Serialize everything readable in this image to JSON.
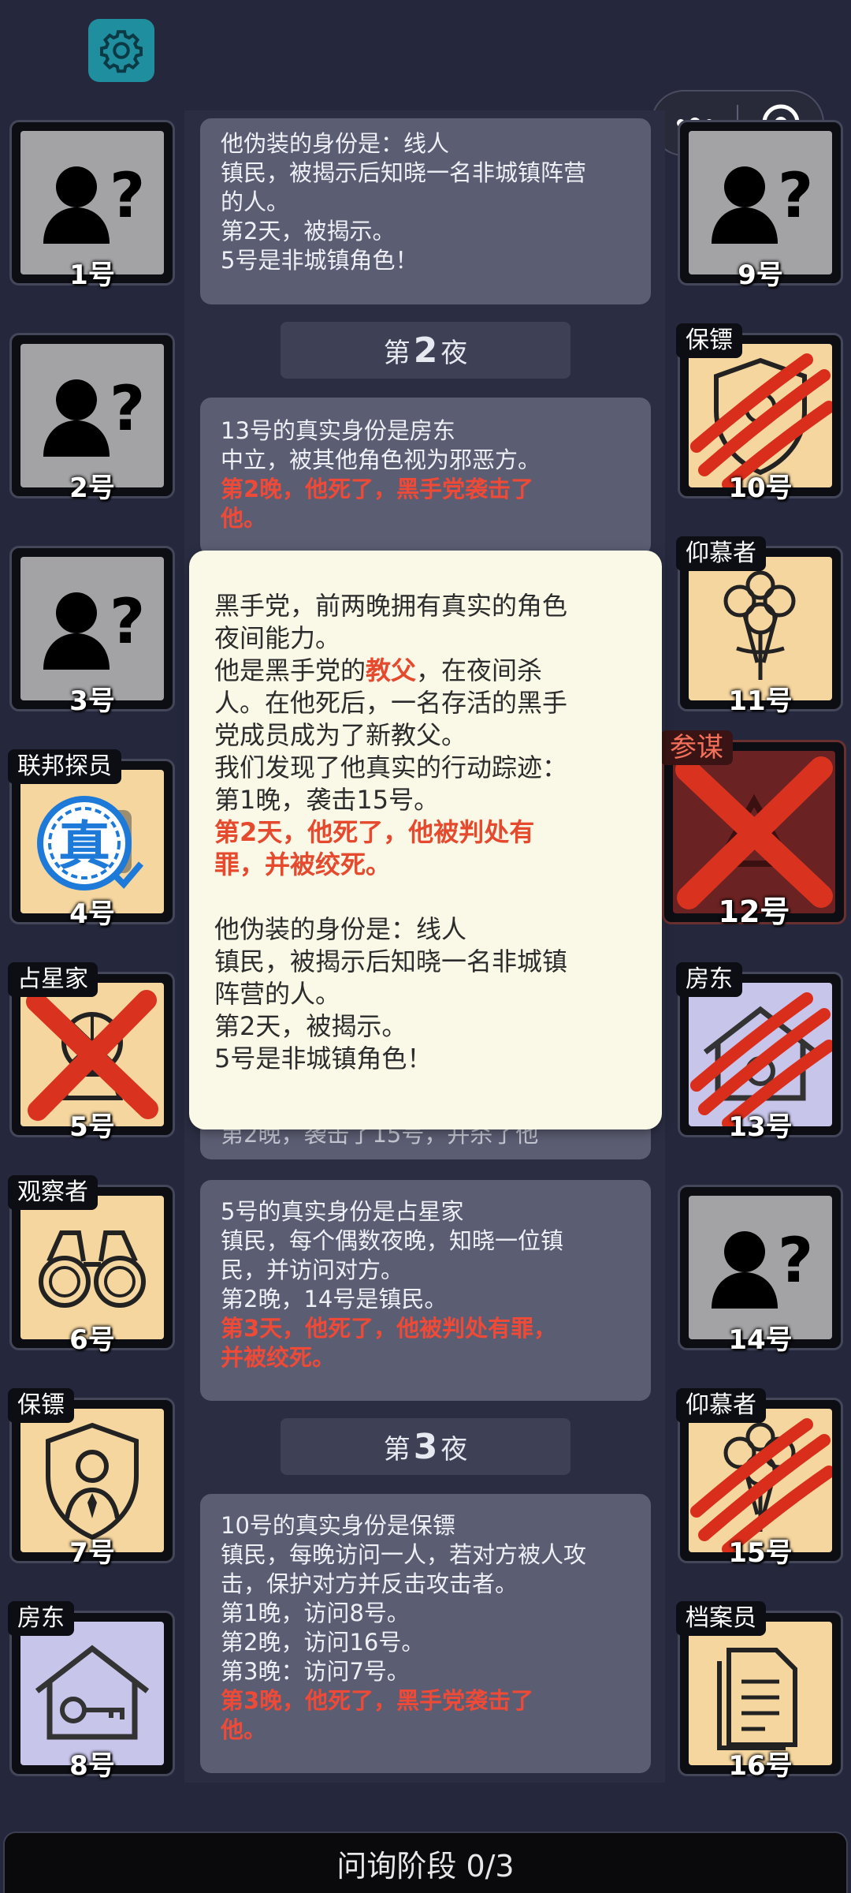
{
  "phase": {
    "label": "问询阶段 0/3"
  },
  "top_card": {
    "lines": [
      "他伪装的身份是：线人",
      "镇民，被揭示后知晓一名非城镇阵营",
      "的人。",
      "第2天，被揭示。",
      "5号是非城镇角色！"
    ]
  },
  "night2": {
    "prefix": "第",
    "number": "2",
    "suffix": "夜"
  },
  "card_13": {
    "lines": [
      "13号的真实身份是房东",
      "中立，被其他角色视为邪恶方。"
    ],
    "death": [
      "第2晚，他死了，黑手党袭击了",
      "他。"
    ]
  },
  "card_hidden_tail": "第2晚，袭击了15号，并杀了他",
  "card_5": {
    "lines": [
      "5号的真实身份是占星家",
      "镇民，每个偶数夜晚，知晓一位镇",
      "民，并访问对方。",
      "第2晚，14号是镇民。"
    ],
    "death": [
      "第3天，他死了，他被判处有罪，",
      "并被绞死。"
    ]
  },
  "night3": {
    "prefix": "第",
    "number": "3",
    "suffix": "夜"
  },
  "card_10": {
    "lines": [
      "10号的真实身份是保镖",
      "镇民，每晚访问一人，若对方被人攻",
      "击，保护对方并反击攻击者。",
      "第1晚，访问8号。",
      "第2晚，访问16号。",
      "第3晚：访问7号。"
    ],
    "death": [
      "第3晚，他死了，黑手党袭击了",
      "他。"
    ]
  },
  "popup": {
    "line1": "黑手党，前两晚拥有真实的角色",
    "line2": "夜间能力。",
    "line3_pre": "他是黑手党的",
    "line3_role": "教父",
    "line3_post": "，在夜间杀",
    "line4": "人。在他死后，一名存活的黑手",
    "line5": "党成员成为了新教父。",
    "line6": "我们发现了他真实的行动踪迹：",
    "line7": "第1晚，袭击15号。",
    "death1": "第2天，他死了，他被判处有",
    "death2": "罪，并被绞死。",
    "line8": "他伪装的身份是：线人",
    "line9": "镇民，被揭示后知晓一名非城镇",
    "line10": "阵营的人。",
    "line11": "第2天，被揭示。",
    "line12": "5号是非城镇角色！"
  },
  "players": {
    "p1": {
      "num": "1号",
      "tag": "",
      "icon": "unknown-person-icon"
    },
    "p2": {
      "num": "2号",
      "tag": "",
      "icon": "unknown-person-icon"
    },
    "p3": {
      "num": "3号",
      "tag": "",
      "icon": "unknown-person-icon"
    },
    "p4": {
      "num": "4号",
      "tag": "联邦探员",
      "icon": "true-seal-icon",
      "seal": "真"
    },
    "p5": {
      "num": "5号",
      "tag": "占星家",
      "icon": "astrologer-icon"
    },
    "p6": {
      "num": "6号",
      "tag": "观察者",
      "icon": "binoculars-icon"
    },
    "p7": {
      "num": "7号",
      "tag": "保镖",
      "icon": "bodyguard-icon"
    },
    "p8": {
      "num": "8号",
      "tag": "房东",
      "icon": "house-key-icon"
    },
    "p9": {
      "num": "9号",
      "tag": "",
      "icon": "unknown-person-icon"
    },
    "p10": {
      "num": "10号",
      "tag": "保镖",
      "icon": "bodyguard-shield-icon"
    },
    "p11": {
      "num": "11号",
      "tag": "仰慕者",
      "icon": "roses-icon"
    },
    "p12": {
      "num": "12号",
      "tag": "参谋",
      "icon": "advisor-icon"
    },
    "p13": {
      "num": "13号",
      "tag": "房东",
      "icon": "house-icon"
    },
    "p14": {
      "num": "14号",
      "tag": "",
      "icon": "unknown-person-icon"
    },
    "p15": {
      "num": "15号",
      "tag": "仰慕者",
      "icon": "roses-icon"
    },
    "p16": {
      "num": "16号",
      "tag": "档案员",
      "icon": "documents-icon"
    }
  },
  "colors": {
    "death_red": "#ee4a37",
    "card_bg": "#5b5d73",
    "popup_bg": "#faf8e7",
    "unknown_bg": "#a3a3a6",
    "tan_bg": "#f5d69f",
    "lavender_bg": "#c7c5ea"
  }
}
